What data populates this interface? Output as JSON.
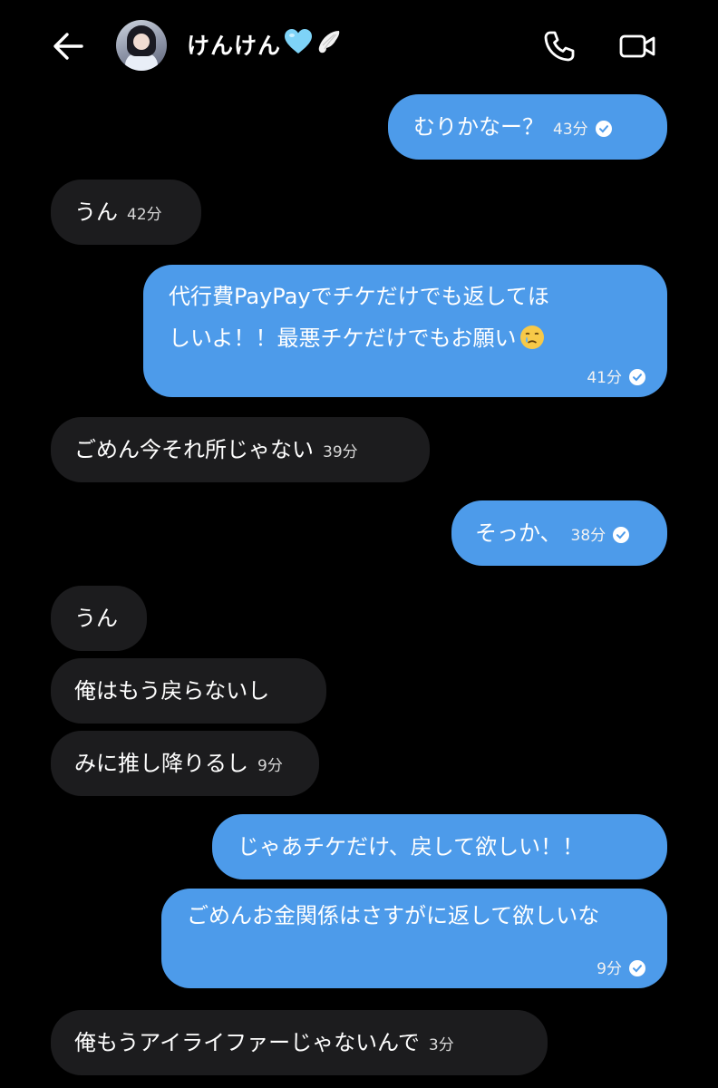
{
  "header": {
    "contact_name": "けんけん",
    "name_emojis": [
      "light-blue-heart-emoji",
      "angel-wing-emoji"
    ],
    "icons": {
      "back": "left-arrow-icon",
      "call": "phone-icon",
      "video": "video-camera-icon"
    }
  },
  "colors": {
    "background": "#000000",
    "outgoing_bubble": "#4d9bea",
    "incoming_bubble": "#1c1c1e",
    "text": "#ffffff"
  },
  "messages": [
    {
      "direction": "outgoing",
      "text": "むりかなー？",
      "time": "43分",
      "read": true
    },
    {
      "direction": "incoming",
      "text": "うん",
      "time": "42分"
    },
    {
      "direction": "outgoing",
      "text": "代行費PayPayでチケだけでも返してほしいよ！！最悪チケだけでもお願い",
      "emoji": "crying-face-emoji",
      "time": "41分",
      "read": true
    },
    {
      "direction": "incoming",
      "text": "ごめん今それ所じゃない",
      "time": "39分"
    },
    {
      "direction": "outgoing",
      "text": "そっか、",
      "time": "38分",
      "read": true
    },
    {
      "direction": "incoming",
      "text": "うん",
      "time": ""
    },
    {
      "direction": "incoming",
      "text": "俺はもう戻らないし",
      "time": ""
    },
    {
      "direction": "incoming",
      "text": "みに推し降りるし",
      "time": "9分"
    },
    {
      "direction": "outgoing",
      "text": "じゃあチケだけ、戻して欲しい！！",
      "time": ""
    },
    {
      "direction": "outgoing",
      "text": "ごめんお金関係はさすがに返して欲しいな",
      "time": "9分",
      "read": true
    },
    {
      "direction": "incoming",
      "text": "俺もうアイライファーじゃないんで",
      "time": "3分"
    }
  ]
}
